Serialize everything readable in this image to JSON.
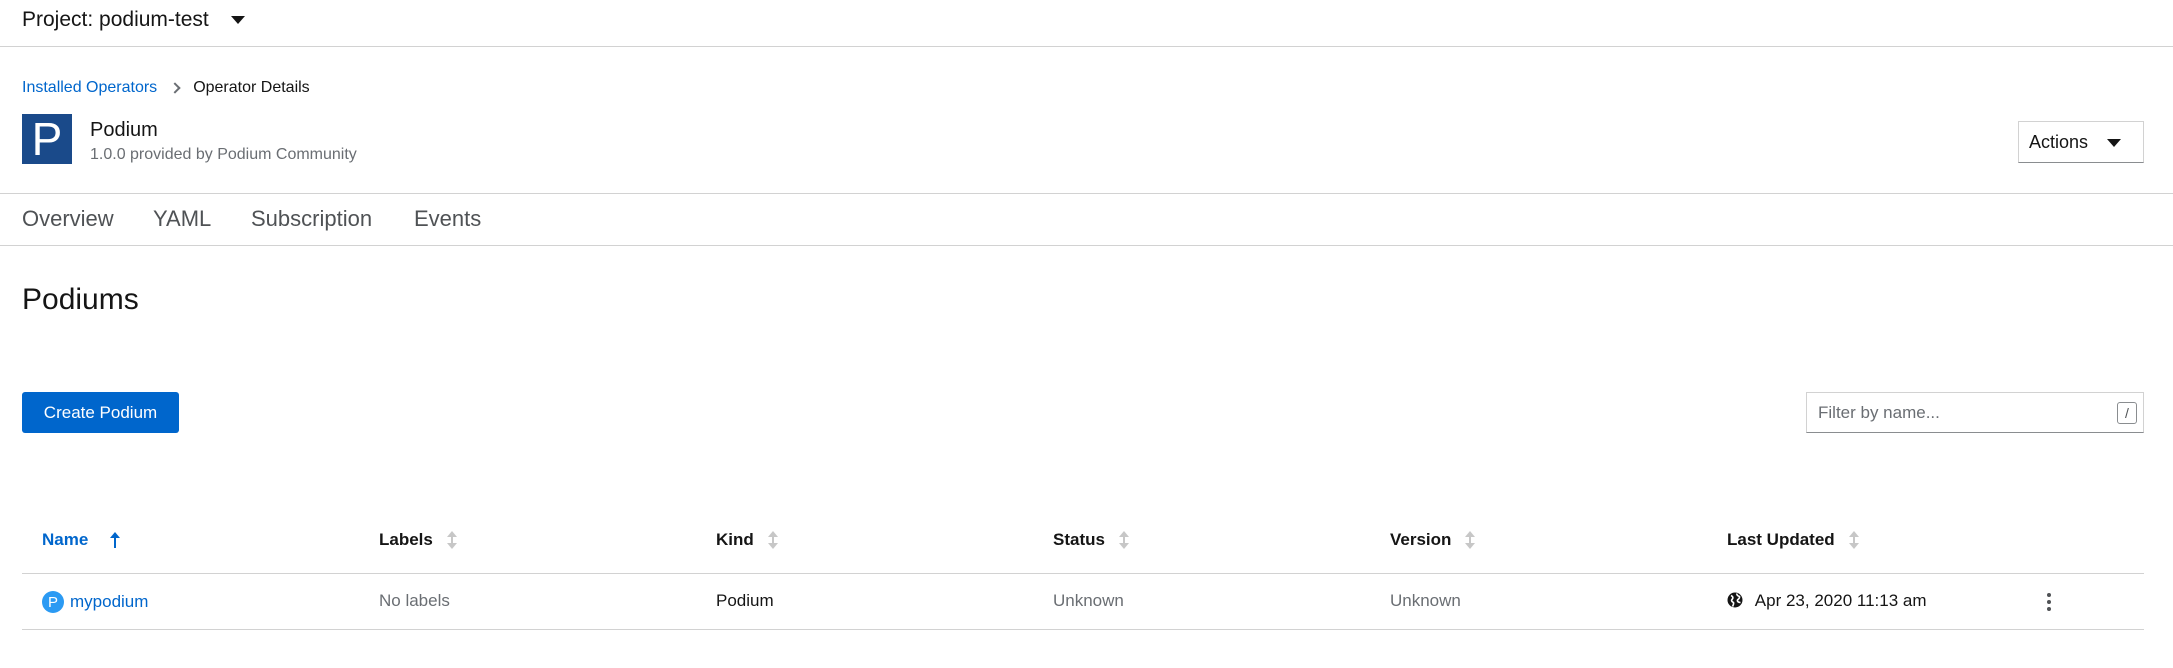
{
  "project": {
    "label": "Project: podium-test"
  },
  "breadcrumb": {
    "parent": "Installed Operators",
    "current": "Operator Details"
  },
  "operator": {
    "logo_letter": "P",
    "name": "Podium",
    "subtitle": "1.0.0 provided by Podium Community"
  },
  "actions": {
    "label": "Actions"
  },
  "tabs": [
    {
      "label": "Overview"
    },
    {
      "label": "YAML"
    },
    {
      "label": "Subscription"
    },
    {
      "label": "Events"
    }
  ],
  "section": {
    "title": "Podiums"
  },
  "create_button": {
    "label": "Create Podium"
  },
  "filter": {
    "placeholder": "Filter by name...",
    "shortcut": "/"
  },
  "table": {
    "columns": [
      {
        "label": "Name",
        "sort": "ascending"
      },
      {
        "label": "Labels",
        "sort": "none"
      },
      {
        "label": "Kind",
        "sort": "none"
      },
      {
        "label": "Status",
        "sort": "none"
      },
      {
        "label": "Version",
        "sort": "none"
      },
      {
        "label": "Last Updated",
        "sort": "none"
      }
    ],
    "rows": [
      {
        "badge": "P",
        "name": "mypodium",
        "labels": "No labels",
        "kind": "Podium",
        "status": "Unknown",
        "version": "Unknown",
        "last_updated": "Apr 23, 2020 11:13 am"
      }
    ]
  },
  "colors": {
    "link": "#0066cc",
    "primary_button": "#0066cc",
    "logo_bg": "#1a4a8a",
    "badge": "#2b9af3"
  },
  "icons": {
    "breadcrumb_separator": "chevron-right-icon",
    "project_caret": "caret-down-icon",
    "row_menu": "kebab-icon",
    "timestamp": "globe-icon"
  }
}
